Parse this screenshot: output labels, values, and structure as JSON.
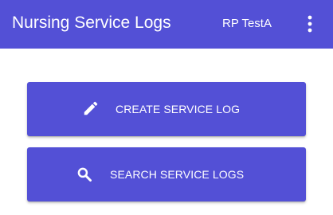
{
  "header": {
    "title": "Nursing Service Logs",
    "user": "RP TestA",
    "menu_icon": "more-vert-icon"
  },
  "actions": [
    {
      "label": "CREATE SERVICE LOG",
      "icon": "pencil-icon"
    },
    {
      "label": "SEARCH SERVICE LOGS",
      "icon": "search-icon"
    }
  ],
  "colors": {
    "primary": "#5350d6",
    "on_primary": "#ffffff",
    "background": "#ffffff"
  }
}
